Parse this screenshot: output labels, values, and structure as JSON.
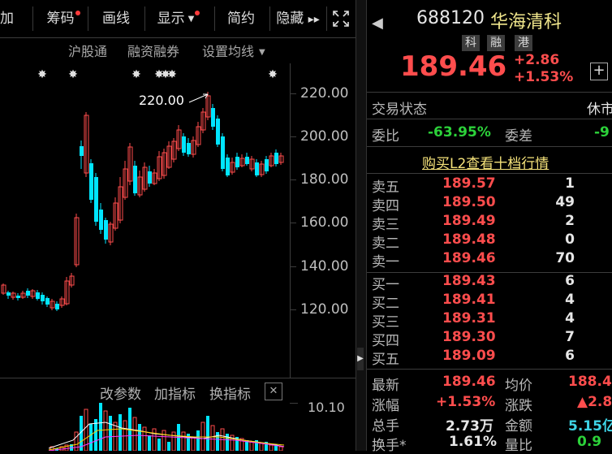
{
  "toolbar": {
    "btn_add": "加",
    "btn_chips": "筹码",
    "btn_draw": "画线",
    "btn_display": "显示",
    "btn_simple": "简约",
    "btn_hide": "隐藏",
    "hide_arrows": "▸▸"
  },
  "subnav": {
    "sh_connect": "沪股通",
    "margin": "融资融券",
    "ma_setting": "设置均线"
  },
  "chart": {
    "price_ticks": [
      "220.00",
      "200.00",
      "180.00",
      "160.00",
      "140.00",
      "120.00"
    ],
    "high_annotation": "220.00",
    "candle_up_color": "#ff4d4d",
    "candle_down_color": "#00e5ff"
  },
  "indicator": {
    "params": "改参数",
    "add": "加指标",
    "switch": "换指标",
    "close": "✕",
    "tick": "10.10"
  },
  "quote": {
    "code": "688120",
    "name": "华海清科",
    "tags": [
      "科",
      "融",
      "港"
    ],
    "price": "189.46",
    "change": "+2.86",
    "change_pct": "+1.53%",
    "add_icon": "+"
  },
  "trade_status": {
    "label": "交易状态",
    "value": "休市"
  },
  "commission": {
    "ratio_label": "委比",
    "ratio_value": "-63.95%",
    "diff_label": "委差",
    "diff_value": "-9"
  },
  "l2_link": "购买L2查看十档行情",
  "order_book": {
    "asks": [
      {
        "label": "卖五",
        "price": "189.57",
        "vol": "1"
      },
      {
        "label": "卖四",
        "price": "189.50",
        "vol": "49"
      },
      {
        "label": "卖三",
        "price": "189.49",
        "vol": "2"
      },
      {
        "label": "卖二",
        "price": "189.48",
        "vol": "0"
      },
      {
        "label": "卖一",
        "price": "189.46",
        "vol": "70"
      }
    ],
    "bids": [
      {
        "label": "买一",
        "price": "189.43",
        "vol": "6"
      },
      {
        "label": "买二",
        "price": "189.41",
        "vol": "4"
      },
      {
        "label": "买三",
        "price": "189.31",
        "vol": "4"
      },
      {
        "label": "买四",
        "price": "189.30",
        "vol": "7"
      },
      {
        "label": "买五",
        "price": "189.09",
        "vol": "6"
      }
    ]
  },
  "stats": {
    "latest_label": "最新",
    "latest_value": "189.46",
    "avg_label": "均价",
    "avg_value": "188.4",
    "pct_label": "涨幅",
    "pct_value": "+1.53%",
    "chg_label": "涨跌",
    "chg_value": "▲2.8",
    "vol_label": "总手",
    "vol_value": "2.73万",
    "amt_label": "金额",
    "amt_value": "5.15亿",
    "turn_label": "换手*",
    "turn_value": "1.61%",
    "qr_label": "量比",
    "qr_value": "0.9"
  }
}
